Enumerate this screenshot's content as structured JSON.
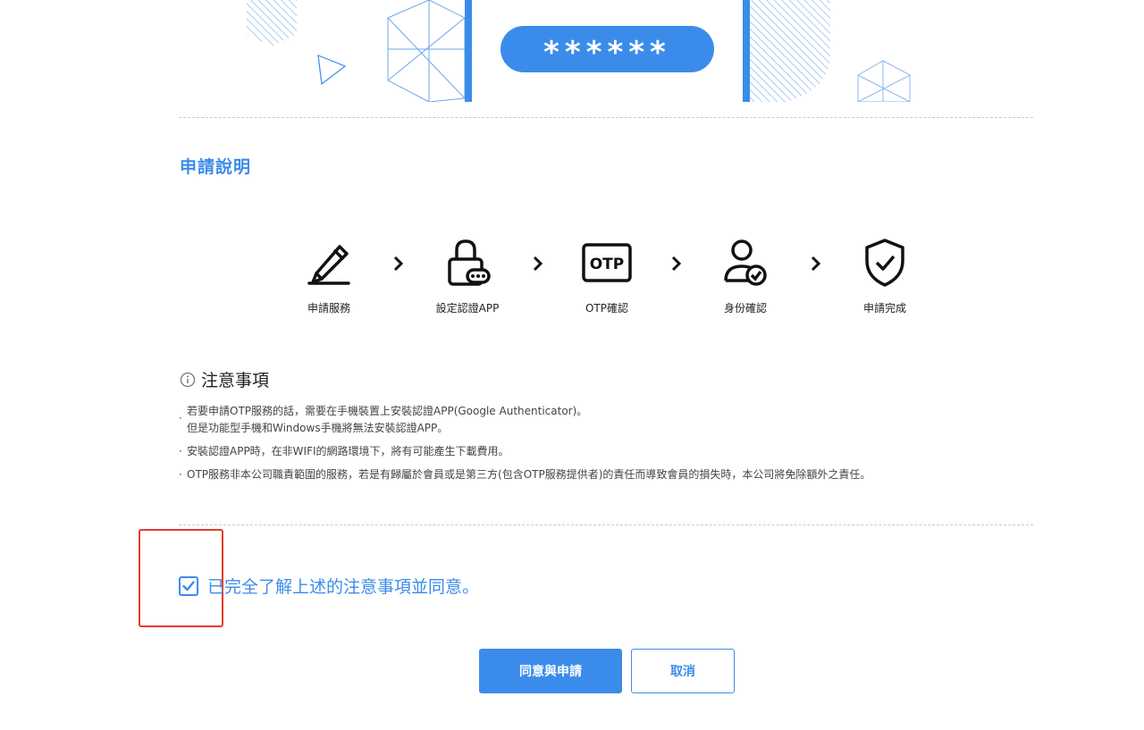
{
  "banner": {
    "password_mask": "******"
  },
  "section": {
    "title": "申請說明"
  },
  "steps": [
    {
      "label": "申請服務",
      "icon": "pencil-icon"
    },
    {
      "label": "設定認證APP",
      "icon": "lock-icon"
    },
    {
      "label": "OTP確認",
      "icon": "otp-icon",
      "icon_text": "OTP"
    },
    {
      "label": "身份確認",
      "icon": "user-check-icon"
    },
    {
      "label": "申請完成",
      "icon": "shield-check-icon"
    }
  ],
  "notice": {
    "title": "注意事項",
    "items": [
      {
        "line1": "若要申請OTP服務的話，需要在手機裝置上安裝認證APP(Google Authenticator)。",
        "line2": "但是功能型手機和Windows手機將無法安裝認證APP。"
      },
      {
        "line1": "安裝認證APP時，在非WIFI的網路環境下，將有可能產生下載費用。"
      },
      {
        "line1": "OTP服務非本公司職責範圍的服務，若是有歸屬於會員或是第三方(包含OTP服務提供者)的責任而導致會員的損失時，本公司將免除額外之責任。"
      }
    ]
  },
  "agreement": {
    "label": "已完全了解上述的注意事項並同意。",
    "checked": true
  },
  "buttons": {
    "agree_apply": "同意與申請",
    "cancel": "取消"
  },
  "colors": {
    "accent": "#3b8cea",
    "highlight": "#e53b2c"
  }
}
